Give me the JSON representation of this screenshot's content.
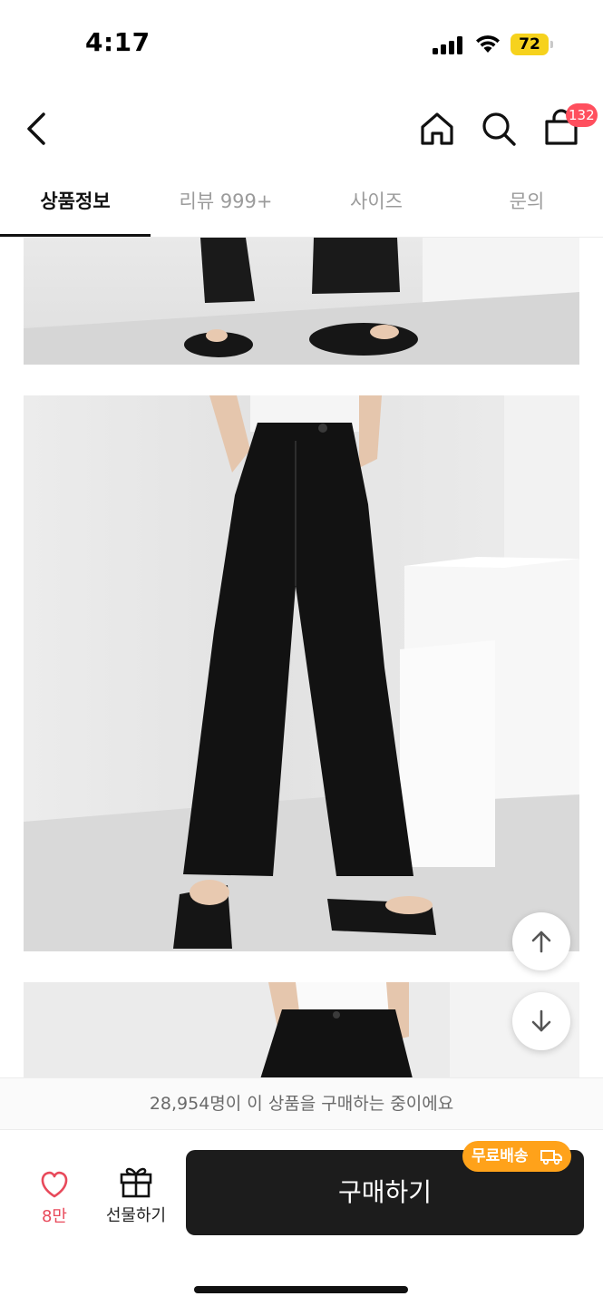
{
  "status_bar": {
    "time": "4:17",
    "battery": "72"
  },
  "nav": {
    "cart_count": "132"
  },
  "tabs": [
    {
      "label": "상품정보"
    },
    {
      "label": "리뷰 999+"
    },
    {
      "label": "사이즈"
    },
    {
      "label": "문의"
    }
  ],
  "purchase_notice": "28,954명이 이 상품을 구매하는 중이에요",
  "bottom": {
    "like_count": "8만",
    "gift_label": "선물하기",
    "buy_label": "구매하기",
    "shipping_badge": "무료배송"
  },
  "colors": {
    "accent_badge": "#ff4f5e",
    "like": "#e8495a",
    "shipping": "#ffa21a",
    "buy_button": "#1c1c1c",
    "battery": "#f6d21d"
  },
  "icons": [
    "back-arrow-icon",
    "home-icon",
    "search-icon",
    "shopping-bag-icon",
    "arrow-up-icon",
    "arrow-down-icon",
    "heart-icon",
    "gift-icon",
    "truck-icon"
  ]
}
